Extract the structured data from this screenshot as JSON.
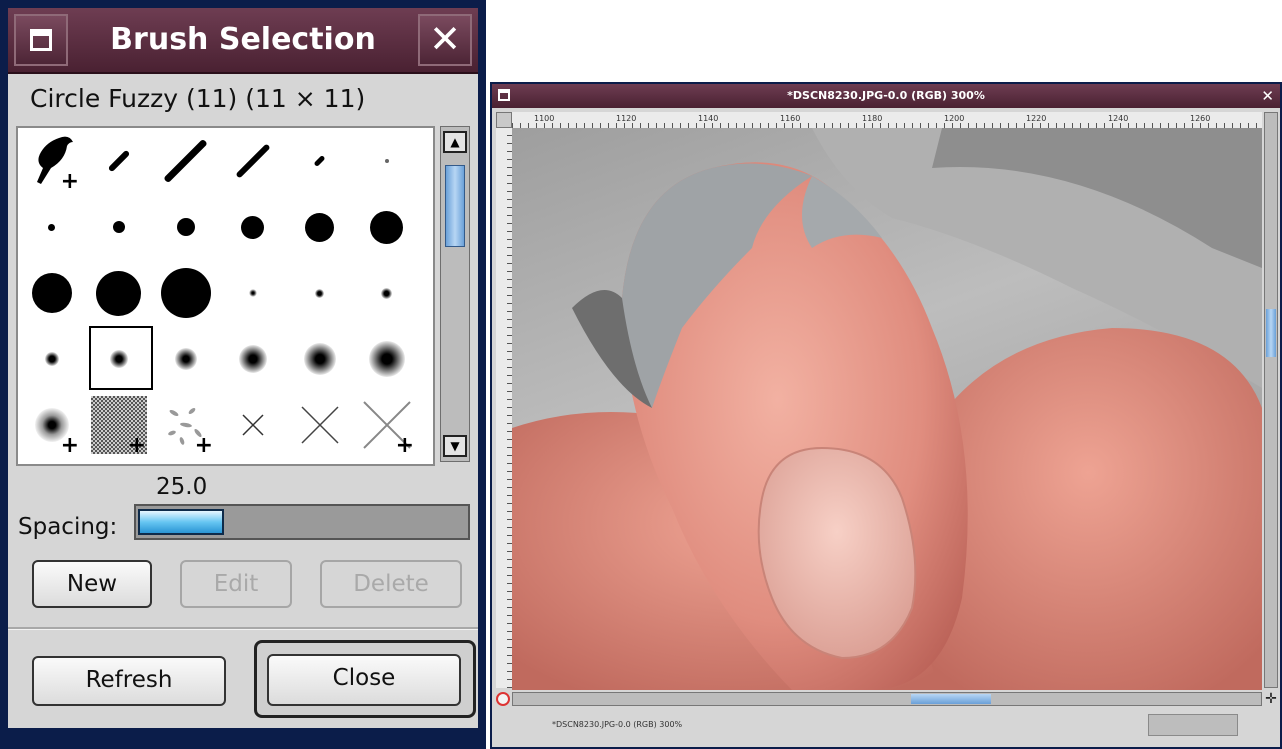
{
  "brush_dialog": {
    "title": "Brush Selection",
    "current_brush": "Circle Fuzzy (11)  (11 × 11)",
    "spacing_label": "Spacing:",
    "spacing_value": "25.0",
    "spacing_fraction": 0.25,
    "buttons": {
      "new": "New",
      "edit": "Edit",
      "delete": "Delete",
      "refresh": "Refresh",
      "close": "Close"
    }
  },
  "image_window": {
    "title": "*DSCN8230.JPG-0.0 (RGB) 300%",
    "status": "*DSCN8230.JPG-0.0 (RGB) 300%",
    "ruler_labels": [
      "1100",
      "1120",
      "1140",
      "1160",
      "1180",
      "1200",
      "1220",
      "1240",
      "1260"
    ]
  }
}
